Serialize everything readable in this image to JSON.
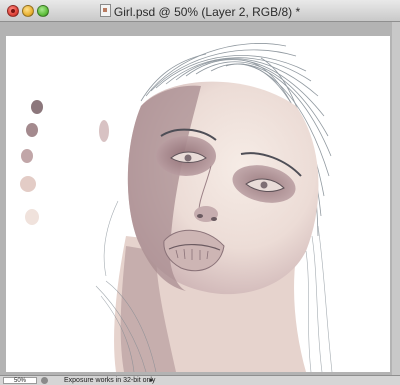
{
  "window": {
    "title": "Girl.psd @ 50% (Layer 2, RGB/8) *"
  },
  "statusbar": {
    "zoom": "50%",
    "info": "Exposure works in 32-bit only",
    "menu_arrow": "▸"
  },
  "colors": {
    "canvas": "#ffffff",
    "skin_light": "#f1e2dc",
    "skin_shadow": "#a6868a",
    "hair": "#7f8a92"
  },
  "icons": {
    "close": "close-button-icon",
    "minimize": "minimize-button-icon",
    "zoom": "zoom-button-icon",
    "document": "document-icon",
    "status": "status-icon"
  }
}
